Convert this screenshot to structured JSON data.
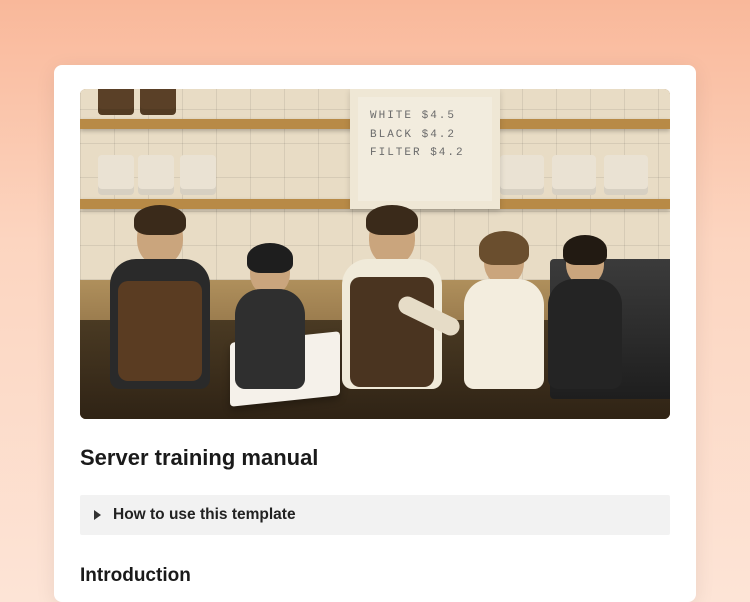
{
  "hero": {
    "menu_board": {
      "line1": "WHITE $4.5",
      "line2": "BLACK $4.2",
      "line3": "FILTER $4.2"
    }
  },
  "document": {
    "title": "Server training manual",
    "collapse_label": "How to use this template",
    "section1_heading": "Introduction"
  }
}
